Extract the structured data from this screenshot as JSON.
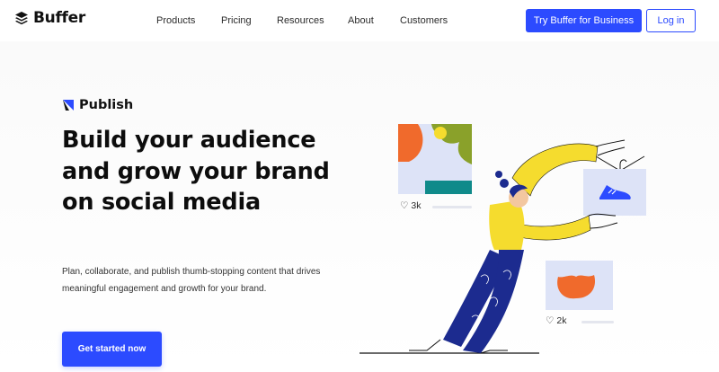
{
  "header": {
    "brand": "Buffer",
    "nav": [
      {
        "label": "Products"
      },
      {
        "label": "Pricing"
      },
      {
        "label": "Resources"
      },
      {
        "label": "About"
      },
      {
        "label": "Customers"
      }
    ],
    "cta_business": "Try Buffer for Business",
    "login": "Log in"
  },
  "hero": {
    "product": "Publish",
    "headline": "Build your audience and grow your brand on social media",
    "subtext": "Plan, collaborate, and publish thumb-stopping content that drives meaningful engagement and growth for your brand.",
    "cta": "Get started now"
  },
  "illustration": {
    "likes_top": "3k",
    "likes_bottom": "2k"
  },
  "colors": {
    "accent": "#2c4bff",
    "yellow": "#f5dc2e",
    "navy": "#1c2b8f",
    "orange": "#f06a2c",
    "teal": "#0f8a8a",
    "olive": "#8aa12a"
  }
}
